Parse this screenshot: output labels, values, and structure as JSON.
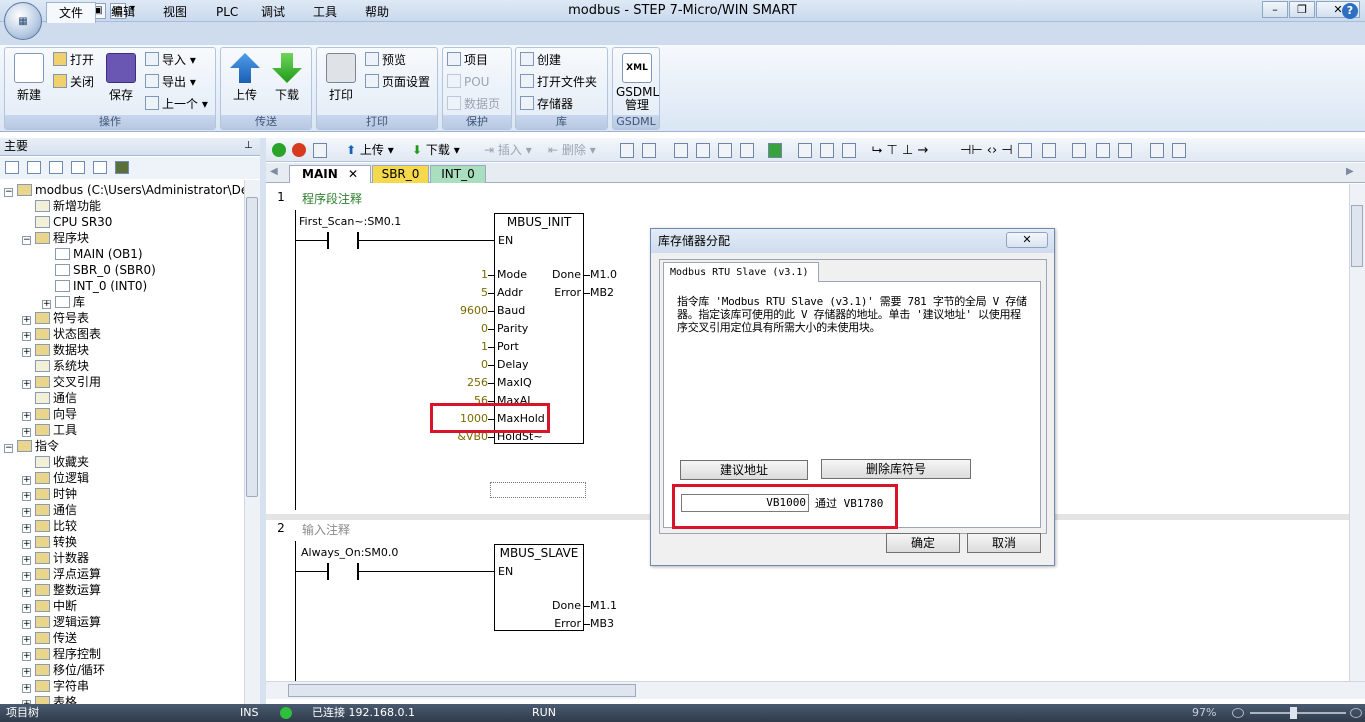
{
  "window": {
    "title": "modbus - STEP 7-Micro/WIN SMART"
  },
  "menu": {
    "tabs": [
      "文件",
      "编辑",
      "视图",
      "PLC",
      "调试",
      "工具",
      "帮助"
    ],
    "active": "文件"
  },
  "ribbon": {
    "groups": [
      {
        "caption": "操作",
        "big": [
          "新建",
          "保存"
        ],
        "small": [
          "打开",
          "关闭",
          "导入",
          "导出",
          "上一个"
        ]
      },
      {
        "caption": "传送",
        "big": [
          "上传",
          "下载"
        ]
      },
      {
        "caption": "打印",
        "big": [
          "打印"
        ],
        "small": [
          "预览",
          "页面设置"
        ]
      },
      {
        "caption": "保护",
        "small": [
          "项目",
          "POU",
          "数据页"
        ]
      },
      {
        "caption": "库",
        "small": [
          "创建",
          "打开文件夹",
          "存储器"
        ]
      },
      {
        "caption": "GSDML",
        "big": [
          "GSDML管理"
        ]
      }
    ],
    "gsdml_icon_text": "XML"
  },
  "left_pane": {
    "header": "主要"
  },
  "tree": [
    {
      "label": "modbus (C:\\Users\\Administrator\\Desktop)",
      "level": 0,
      "exp": "−"
    },
    {
      "label": "新增功能",
      "level": 1
    },
    {
      "label": "CPU SR30",
      "level": 1
    },
    {
      "label": "程序块",
      "level": 1,
      "exp": "−"
    },
    {
      "label": "MAIN (OB1)",
      "level": 2
    },
    {
      "label": "SBR_0 (SBR0)",
      "level": 2
    },
    {
      "label": "INT_0 (INT0)",
      "level": 2
    },
    {
      "label": "库",
      "level": 2,
      "exp": "+"
    },
    {
      "label": "符号表",
      "level": 1,
      "exp": "+"
    },
    {
      "label": "状态图表",
      "level": 1,
      "exp": "+"
    },
    {
      "label": "数据块",
      "level": 1,
      "exp": "+"
    },
    {
      "label": "系统块",
      "level": 1
    },
    {
      "label": "交叉引用",
      "level": 1,
      "exp": "+"
    },
    {
      "label": "通信",
      "level": 1
    },
    {
      "label": "向导",
      "level": 1,
      "exp": "+"
    },
    {
      "label": "工具",
      "level": 1,
      "exp": "+"
    },
    {
      "label": "指令",
      "level": 0,
      "exp": "−"
    },
    {
      "label": "收藏夹",
      "level": 1
    },
    {
      "label": "位逻辑",
      "level": 1,
      "exp": "+"
    },
    {
      "label": "时钟",
      "level": 1,
      "exp": "+"
    },
    {
      "label": "通信",
      "level": 1,
      "exp": "+"
    },
    {
      "label": "比较",
      "level": 1,
      "exp": "+"
    },
    {
      "label": "转换",
      "level": 1,
      "exp": "+"
    },
    {
      "label": "计数器",
      "level": 1,
      "exp": "+"
    },
    {
      "label": "浮点运算",
      "level": 1,
      "exp": "+"
    },
    {
      "label": "整数运算",
      "level": 1,
      "exp": "+"
    },
    {
      "label": "中断",
      "level": 1,
      "exp": "+"
    },
    {
      "label": "逻辑运算",
      "level": 1,
      "exp": "+"
    },
    {
      "label": "传送",
      "level": 1,
      "exp": "+"
    },
    {
      "label": "程序控制",
      "level": 1,
      "exp": "+"
    },
    {
      "label": "移位/循环",
      "level": 1,
      "exp": "+"
    },
    {
      "label": "字符串",
      "level": 1,
      "exp": "+"
    },
    {
      "label": "表格",
      "level": 1,
      "exp": "+"
    }
  ],
  "editor_toolbar": {
    "upload": "上传",
    "download": "下载",
    "insert": "插入",
    "delete": "删除"
  },
  "editor_tabs": [
    "MAIN",
    "SBR_0",
    "INT_0"
  ],
  "network1": {
    "number": "1",
    "comment": "程序段注释",
    "contact": "First_Scan~:SM0.1",
    "block": "MBUS_INIT",
    "en": "EN",
    "inputs": [
      {
        "pin": "Mode",
        "value": "1"
      },
      {
        "pin": "Addr",
        "value": "5"
      },
      {
        "pin": "Baud",
        "value": "9600"
      },
      {
        "pin": "Parity",
        "value": "0"
      },
      {
        "pin": "Port",
        "value": "1"
      },
      {
        "pin": "Delay",
        "value": "0"
      },
      {
        "pin": "MaxIQ",
        "value": "256"
      },
      {
        "pin": "MaxAI",
        "value": "56"
      },
      {
        "pin": "MaxHold",
        "value": "1000"
      },
      {
        "pin": "HoldSt~",
        "value": "&VB0"
      }
    ],
    "outputs": [
      {
        "pin": "Done",
        "value": "M1.0"
      },
      {
        "pin": "Error",
        "value": "MB2"
      }
    ]
  },
  "network2": {
    "number": "2",
    "comment": "输入注释",
    "contact": "Always_On:SM0.0",
    "block": "MBUS_SLAVE",
    "en": "EN",
    "outputs": [
      {
        "pin": "Done",
        "value": "M1.1"
      },
      {
        "pin": "Error",
        "value": "MB3"
      }
    ]
  },
  "dialog": {
    "title": "库存储器分配",
    "tab": "Modbus RTU Slave (v3.1)",
    "message": "指令库 'Modbus RTU Slave (v3.1)' 需要 781 字节的全局 V 存储器。指定该库可使用的此 V 存储器的地址。单击 '建议地址' 以使用程序交叉引用定位具有所需大小的未使用块。",
    "suggest_btn": "建议地址",
    "delete_btn": "删除库符号",
    "start_addr": "VB1000",
    "through_label": "通过 VB1780",
    "ok": "确定",
    "cancel": "取消"
  },
  "status": {
    "left": "项目树",
    "mode": "INS",
    "conn": "已连接 192.168.0.1",
    "run": "RUN",
    "zoom": "97%"
  },
  "colors": {
    "highlight": "#d9142a",
    "accent": "#2e6fc2"
  }
}
